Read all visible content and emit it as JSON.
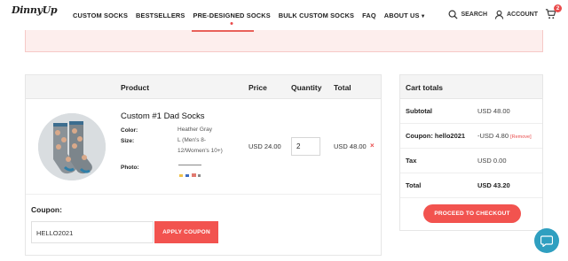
{
  "header": {
    "logo": "DinnyUp",
    "nav": [
      {
        "label": "CUSTOM SOCKS"
      },
      {
        "label": "BESTSELLERS"
      },
      {
        "label": "PRE-DESIGNED SOCKS"
      },
      {
        "label": "BULK CUSTOM SOCKS"
      },
      {
        "label": "FAQ"
      },
      {
        "label": "ABOUT US"
      }
    ],
    "search_label": "SEARCH",
    "account_label": "ACCOUNT",
    "cart_count": "2",
    "icons": {
      "search": "search-icon",
      "account": "user-icon",
      "cart": "cart-icon"
    }
  },
  "cart": {
    "columns": [
      "Product",
      "Price",
      "Quantity",
      "Total"
    ],
    "item": {
      "title": "Custom #1 Dad Socks",
      "color_label": "Color:",
      "color_value": "Heather Gray",
      "size_label": "Size:",
      "size_value": "L (Men's 8-12/Women's 10+)",
      "photo_label": "Photo:",
      "price": "USD 24.00",
      "quantity": "2",
      "total": "USD 48.00",
      "remove": "×"
    },
    "coupon_label": "Coupon:",
    "coupon_value": "HELLO2021",
    "apply_button": "APPLY COUPON"
  },
  "totals": {
    "heading": "Cart totals",
    "rows": [
      {
        "label": "Subtotal",
        "value": "USD 48.00"
      },
      {
        "label": "Coupon: hello2021",
        "value": "-USD 4.80",
        "remove": "[Remove]"
      },
      {
        "label": "Tax",
        "value": "USD 0.00"
      },
      {
        "label": "Total",
        "value": "USD 43.20"
      }
    ],
    "checkout_button": "PROCEED TO CHECKOUT"
  },
  "colors": {
    "accent": "#f2534f",
    "notice_bg": "#fdeeed",
    "chat": "#2f9fc0"
  }
}
